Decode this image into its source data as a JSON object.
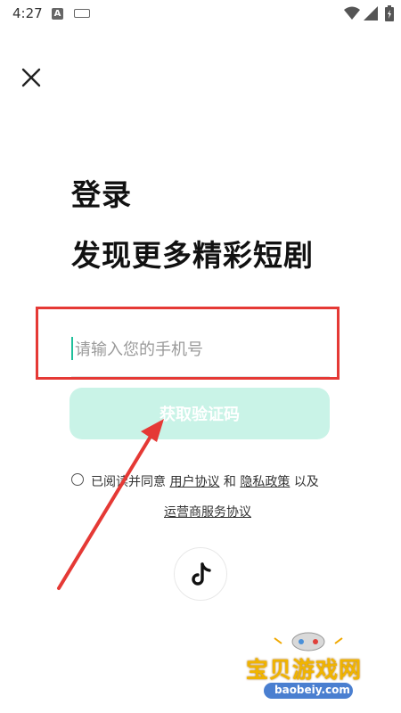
{
  "status_bar": {
    "time": "4:27",
    "app_badge": "A"
  },
  "close_icon": "close-icon",
  "title": "登录",
  "subtitle": "发现更多精彩短剧",
  "phone_input": {
    "placeholder": "请输入您的手机号",
    "value": ""
  },
  "get_code_button": {
    "label": "获取验证码"
  },
  "agreement": {
    "prefix": "已阅读并同意",
    "user_agreement": "用户协议",
    "and": "和",
    "privacy_policy": "隐私政策",
    "and_also": "以及",
    "operator_agreement": "运营商服务协议"
  },
  "douyin_login_icon": "tiktok-icon",
  "watermark": {
    "brand": "宝贝游戏网",
    "domain": "baobeiy.com"
  },
  "colors": {
    "accent": "#1fbf9a",
    "button_disabled": "#c9f3e7",
    "annotation_red": "#e53935"
  }
}
